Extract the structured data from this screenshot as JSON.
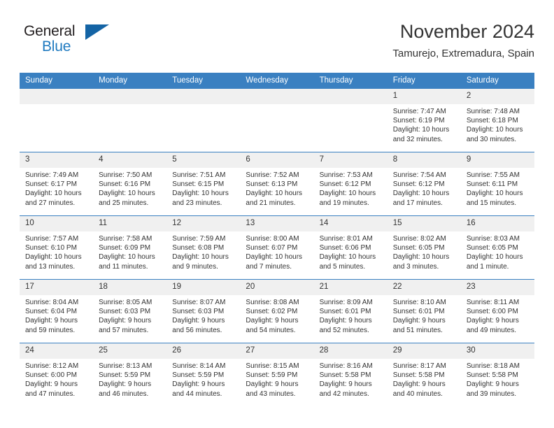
{
  "logo": {
    "word_one": "General",
    "word_two": "Blue",
    "triangle": "triangle-mark"
  },
  "header": {
    "title": "November 2024",
    "location": "Tamurejo, Extremadura, Spain"
  },
  "calendar": {
    "day_headers": [
      "Sunday",
      "Monday",
      "Tuesday",
      "Wednesday",
      "Thursday",
      "Friday",
      "Saturday"
    ],
    "accent_color": "#3a80c1",
    "daynum_band_color": "#f0f0f0",
    "text_color": "#333333",
    "weeks": [
      [
        {
          "blank": true
        },
        {
          "blank": true
        },
        {
          "blank": true
        },
        {
          "blank": true
        },
        {
          "blank": true
        },
        {
          "day": "1",
          "sunrise": "Sunrise: 7:47 AM",
          "sunset": "Sunset: 6:19 PM",
          "daylight": "Daylight: 10 hours and 32 minutes."
        },
        {
          "day": "2",
          "sunrise": "Sunrise: 7:48 AM",
          "sunset": "Sunset: 6:18 PM",
          "daylight": "Daylight: 10 hours and 30 minutes."
        }
      ],
      [
        {
          "day": "3",
          "sunrise": "Sunrise: 7:49 AM",
          "sunset": "Sunset: 6:17 PM",
          "daylight": "Daylight: 10 hours and 27 minutes."
        },
        {
          "day": "4",
          "sunrise": "Sunrise: 7:50 AM",
          "sunset": "Sunset: 6:16 PM",
          "daylight": "Daylight: 10 hours and 25 minutes."
        },
        {
          "day": "5",
          "sunrise": "Sunrise: 7:51 AM",
          "sunset": "Sunset: 6:15 PM",
          "daylight": "Daylight: 10 hours and 23 minutes."
        },
        {
          "day": "6",
          "sunrise": "Sunrise: 7:52 AM",
          "sunset": "Sunset: 6:13 PM",
          "daylight": "Daylight: 10 hours and 21 minutes."
        },
        {
          "day": "7",
          "sunrise": "Sunrise: 7:53 AM",
          "sunset": "Sunset: 6:12 PM",
          "daylight": "Daylight: 10 hours and 19 minutes."
        },
        {
          "day": "8",
          "sunrise": "Sunrise: 7:54 AM",
          "sunset": "Sunset: 6:12 PM",
          "daylight": "Daylight: 10 hours and 17 minutes."
        },
        {
          "day": "9",
          "sunrise": "Sunrise: 7:55 AM",
          "sunset": "Sunset: 6:11 PM",
          "daylight": "Daylight: 10 hours and 15 minutes."
        }
      ],
      [
        {
          "day": "10",
          "sunrise": "Sunrise: 7:57 AM",
          "sunset": "Sunset: 6:10 PM",
          "daylight": "Daylight: 10 hours and 13 minutes."
        },
        {
          "day": "11",
          "sunrise": "Sunrise: 7:58 AM",
          "sunset": "Sunset: 6:09 PM",
          "daylight": "Daylight: 10 hours and 11 minutes."
        },
        {
          "day": "12",
          "sunrise": "Sunrise: 7:59 AM",
          "sunset": "Sunset: 6:08 PM",
          "daylight": "Daylight: 10 hours and 9 minutes."
        },
        {
          "day": "13",
          "sunrise": "Sunrise: 8:00 AM",
          "sunset": "Sunset: 6:07 PM",
          "daylight": "Daylight: 10 hours and 7 minutes."
        },
        {
          "day": "14",
          "sunrise": "Sunrise: 8:01 AM",
          "sunset": "Sunset: 6:06 PM",
          "daylight": "Daylight: 10 hours and 5 minutes."
        },
        {
          "day": "15",
          "sunrise": "Sunrise: 8:02 AM",
          "sunset": "Sunset: 6:05 PM",
          "daylight": "Daylight: 10 hours and 3 minutes."
        },
        {
          "day": "16",
          "sunrise": "Sunrise: 8:03 AM",
          "sunset": "Sunset: 6:05 PM",
          "daylight": "Daylight: 10 hours and 1 minute."
        }
      ],
      [
        {
          "day": "17",
          "sunrise": "Sunrise: 8:04 AM",
          "sunset": "Sunset: 6:04 PM",
          "daylight": "Daylight: 9 hours and 59 minutes."
        },
        {
          "day": "18",
          "sunrise": "Sunrise: 8:05 AM",
          "sunset": "Sunset: 6:03 PM",
          "daylight": "Daylight: 9 hours and 57 minutes."
        },
        {
          "day": "19",
          "sunrise": "Sunrise: 8:07 AM",
          "sunset": "Sunset: 6:03 PM",
          "daylight": "Daylight: 9 hours and 56 minutes."
        },
        {
          "day": "20",
          "sunrise": "Sunrise: 8:08 AM",
          "sunset": "Sunset: 6:02 PM",
          "daylight": "Daylight: 9 hours and 54 minutes."
        },
        {
          "day": "21",
          "sunrise": "Sunrise: 8:09 AM",
          "sunset": "Sunset: 6:01 PM",
          "daylight": "Daylight: 9 hours and 52 minutes."
        },
        {
          "day": "22",
          "sunrise": "Sunrise: 8:10 AM",
          "sunset": "Sunset: 6:01 PM",
          "daylight": "Daylight: 9 hours and 51 minutes."
        },
        {
          "day": "23",
          "sunrise": "Sunrise: 8:11 AM",
          "sunset": "Sunset: 6:00 PM",
          "daylight": "Daylight: 9 hours and 49 minutes."
        }
      ],
      [
        {
          "day": "24",
          "sunrise": "Sunrise: 8:12 AM",
          "sunset": "Sunset: 6:00 PM",
          "daylight": "Daylight: 9 hours and 47 minutes."
        },
        {
          "day": "25",
          "sunrise": "Sunrise: 8:13 AM",
          "sunset": "Sunset: 5:59 PM",
          "daylight": "Daylight: 9 hours and 46 minutes."
        },
        {
          "day": "26",
          "sunrise": "Sunrise: 8:14 AM",
          "sunset": "Sunset: 5:59 PM",
          "daylight": "Daylight: 9 hours and 44 minutes."
        },
        {
          "day": "27",
          "sunrise": "Sunrise: 8:15 AM",
          "sunset": "Sunset: 5:59 PM",
          "daylight": "Daylight: 9 hours and 43 minutes."
        },
        {
          "day": "28",
          "sunrise": "Sunrise: 8:16 AM",
          "sunset": "Sunset: 5:58 PM",
          "daylight": "Daylight: 9 hours and 42 minutes."
        },
        {
          "day": "29",
          "sunrise": "Sunrise: 8:17 AM",
          "sunset": "Sunset: 5:58 PM",
          "daylight": "Daylight: 9 hours and 40 minutes."
        },
        {
          "day": "30",
          "sunrise": "Sunrise: 8:18 AM",
          "sunset": "Sunset: 5:58 PM",
          "daylight": "Daylight: 9 hours and 39 minutes."
        }
      ]
    ]
  }
}
